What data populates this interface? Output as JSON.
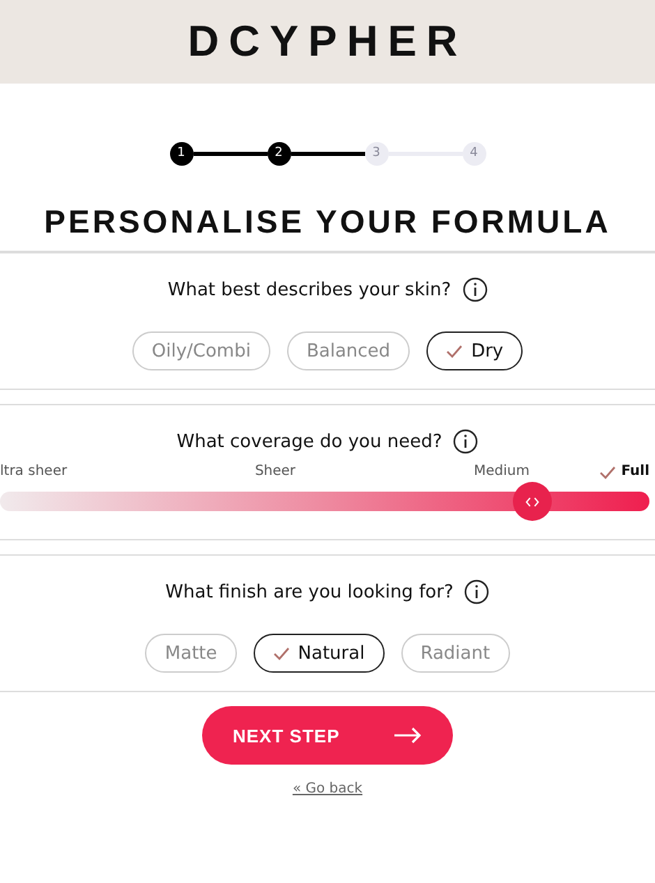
{
  "brand": "DCYPHER",
  "steps": [
    {
      "label": "1",
      "done": true
    },
    {
      "label": "2",
      "done": true
    },
    {
      "label": "3",
      "done": false
    },
    {
      "label": "4",
      "done": false
    }
  ],
  "title": "PERSONALISE YOUR FORMULA",
  "sections": [
    {
      "kind": "pills",
      "question": "What best describes your skin?",
      "options": [
        {
          "label": "Oily/Combi",
          "selected": false
        },
        {
          "label": "Balanced",
          "selected": false
        },
        {
          "label": "Dry",
          "selected": true
        }
      ]
    },
    {
      "kind": "slider",
      "question": "What coverage do you need?",
      "level": 0.82,
      "options": [
        {
          "label": "ltra sheer",
          "selected": false
        },
        {
          "label": "Sheer",
          "selected": false
        },
        {
          "label": "Medium",
          "selected": false
        },
        {
          "label": "Full",
          "selected": true
        }
      ]
    },
    {
      "kind": "pills",
      "question": "What finish are you looking for?",
      "options": [
        {
          "label": "Matte",
          "selected": false
        },
        {
          "label": "Natural",
          "selected": true
        },
        {
          "label": "Radiant",
          "selected": false
        }
      ]
    }
  ],
  "next_button": "NEXT STEP",
  "back_link": "« Go back"
}
